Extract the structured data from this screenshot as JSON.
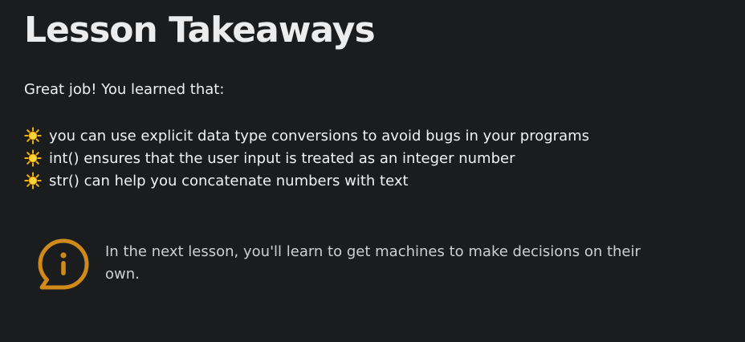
{
  "page": {
    "title": "Lesson Takeaways"
  },
  "intro": {
    "text": "Great job! You learned that:"
  },
  "takeaways": [
    {
      "icon": "sun-icon",
      "text": "you can use explicit data type conversions to avoid bugs in your programs"
    },
    {
      "icon": "sun-icon",
      "text": "int() ensures that the user input is treated as an integer number"
    },
    {
      "icon": "sun-icon",
      "text": "str() can help you concatenate numbers with text"
    }
  ],
  "callout": {
    "icon": "info-bubble-icon",
    "text": "In the next lesson, you'll learn to get machines to make decisions on their own."
  },
  "colors": {
    "background": "#1b1c1e",
    "accent": "#d08a1a",
    "text": "#f2f2f2",
    "muted_text": "#cfcfcf"
  }
}
